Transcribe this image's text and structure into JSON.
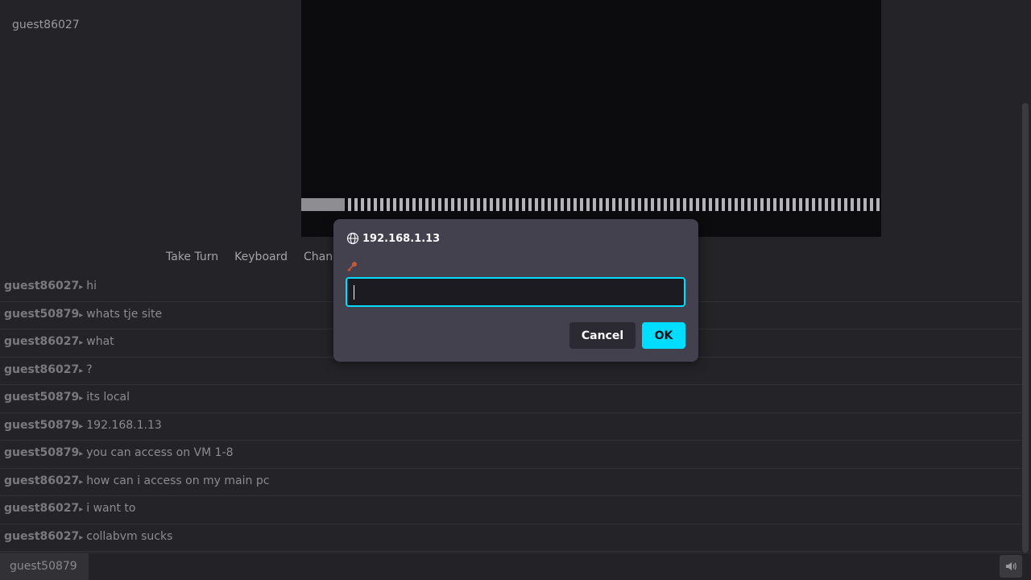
{
  "userlist": {
    "users": [
      "guest86027"
    ]
  },
  "vm": {
    "turn_progress_percent": 7.5
  },
  "controls": {
    "take_turn": "Take Turn",
    "keyboard": "Keyboard",
    "change": "Chang"
  },
  "chat": {
    "messages": [
      {
        "user": "guest86027",
        "text": "hi"
      },
      {
        "user": "guest50879",
        "text": "whats tje site"
      },
      {
        "user": "guest86027",
        "text": "what"
      },
      {
        "user": "guest86027",
        "text": "?"
      },
      {
        "user": "guest50879",
        "text": "its local"
      },
      {
        "user": "guest50879",
        "text": "192.168.1.13"
      },
      {
        "user": "guest50879",
        "text": "you can access on VM 1-8"
      },
      {
        "user": "guest86027",
        "text": "how can i access on my main pc"
      },
      {
        "user": "guest86027",
        "text": "i want to"
      },
      {
        "user": "guest86027",
        "text": "collabvm sucks"
      }
    ],
    "separator": "▸"
  },
  "bottom": {
    "username": "guest50879",
    "input_value": "",
    "input_placeholder": "",
    "volume_icon": "speaker-icon"
  },
  "dialog": {
    "host": "192.168.1.13",
    "input_value": "",
    "cancel_label": "Cancel",
    "ok_label": "OK",
    "globe_icon": "globe-icon",
    "key_icon": "key-icon"
  },
  "colors": {
    "accent": "#00ddff",
    "dialog_bg": "#42414d",
    "page_bg": "#242428"
  }
}
